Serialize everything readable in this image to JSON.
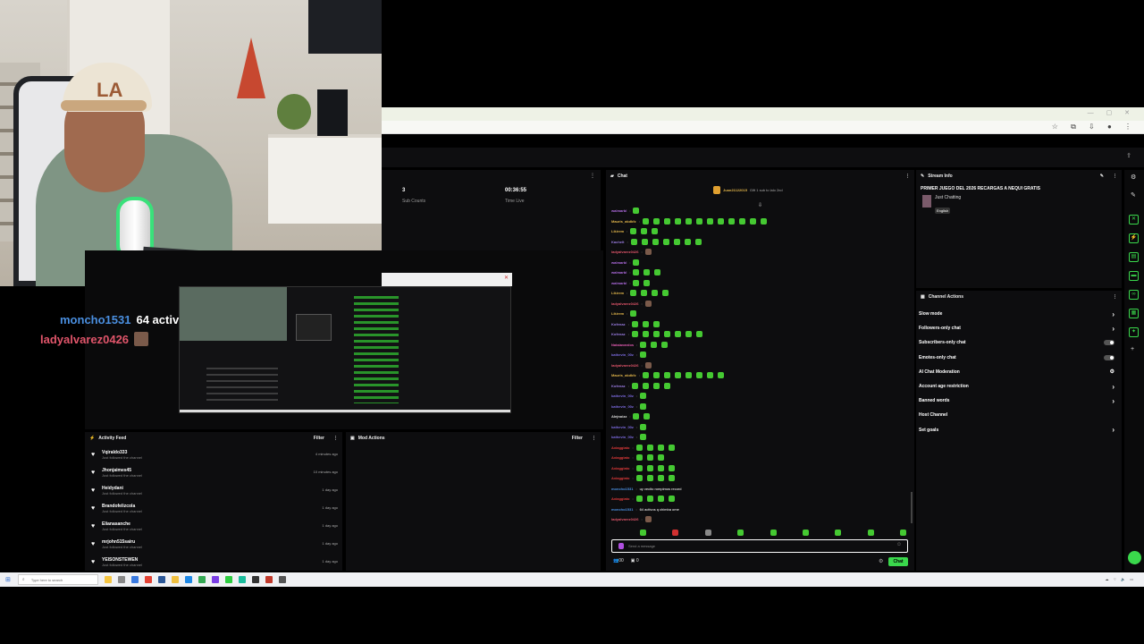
{
  "webcam": {
    "cap_logo": "LA",
    "sign_text": ""
  },
  "overlay": {
    "lines": [
      {
        "name": "moncho1531",
        "message": "64 activos q chimba ome",
        "color": "#4a8fe0"
      },
      {
        "name": "ladyalvarez0426",
        "message": "",
        "color": "#e0556a"
      }
    ]
  },
  "stats": {
    "sub_count": {
      "value": "3",
      "label": "Sub Counts"
    },
    "time_live": {
      "value": "00:36:55",
      "label": "Time Live"
    }
  },
  "activity_feed": {
    "title": "Activity Feed",
    "filter_label": "Filter",
    "items": [
      {
        "name": "Vqiraldo333",
        "action": "Just followed the channel",
        "time": "4 minutes ago"
      },
      {
        "name": "Jhonjaimes45",
        "action": "Just followed the channel",
        "time": "10 minutes ago"
      },
      {
        "name": "Heidydani",
        "action": "Just followed the channel",
        "time": "1 day ago"
      },
      {
        "name": "Brandofelizcola",
        "action": "Just followed the channel",
        "time": "1 day ago"
      },
      {
        "name": "Elianasanche",
        "action": "Just followed the channel",
        "time": "1 day ago"
      },
      {
        "name": "mrjohn515sairu",
        "action": "Just followed the channel",
        "time": "1 day ago"
      },
      {
        "name": "YEISONSTEWEN",
        "action": "Just followed the channel",
        "time": "1 day ago"
      }
    ]
  },
  "mod_actions": {
    "title": "Mod Actions",
    "filter_label": "Filter"
  },
  "chat": {
    "title": "Chat",
    "gift_banner": {
      "user": "Juan21122015",
      "text": "Gift 1 sub to lalo 2nd"
    },
    "lines": [
      {
        "user": "walmarbl",
        "color": "#b06be0",
        "emotes": 1,
        "text": ""
      },
      {
        "user": "Mauris_akdkfz",
        "color": "#e0b44a",
        "emotes": 12,
        "text": ""
      },
      {
        "user": "Likirem",
        "color": "#e0b44a",
        "emotes": 3,
        "text": ""
      },
      {
        "user": "Kachelt",
        "color": "#9a7ce0",
        "emotes": 7,
        "text": ""
      },
      {
        "user": "ladyalvarez0426",
        "color": "#e0556a",
        "emotes": 1,
        "text": ""
      },
      {
        "user": "walmarbl",
        "color": "#b06be0",
        "emotes": 1,
        "text": ""
      },
      {
        "user": "walmarbl",
        "color": "#b06be0",
        "emotes": 3,
        "text": ""
      },
      {
        "user": "walmarbl",
        "color": "#b06be0",
        "emotes": 2,
        "text": ""
      },
      {
        "user": "Likirem",
        "color": "#e0b44a",
        "emotes": 4,
        "text": ""
      },
      {
        "user": "ladyalvarez0426",
        "color": "#e0556a",
        "emotes": 1,
        "text": ""
      },
      {
        "user": "Likirem",
        "color": "#e0b44a",
        "emotes": 1,
        "text": ""
      },
      {
        "user": "Kofenaz",
        "color": "#9a7ce0",
        "emotes": 3,
        "text": ""
      },
      {
        "user": "Kofenaz",
        "color": "#9a7ce0",
        "emotes": 7,
        "text": ""
      },
      {
        "user": "Nataiavardos",
        "color": "#e05bb0",
        "emotes": 3,
        "text": ""
      },
      {
        "user": "kathevin_00z",
        "color": "#7c6be0",
        "emotes": 1,
        "text": ""
      },
      {
        "user": "ladyalvarez0426",
        "color": "#e0556a",
        "emotes": 1,
        "text": ""
      },
      {
        "user": "Mauris_akdkfz",
        "color": "#e0b44a",
        "emotes": 8,
        "text": ""
      },
      {
        "user": "Kofenaz",
        "color": "#9a7ce0",
        "emotes": 4,
        "text": ""
      },
      {
        "user": "kathevin_00z",
        "color": "#7c6be0",
        "emotes": 1,
        "text": ""
      },
      {
        "user": "kathevin_00z",
        "color": "#7c6be0",
        "emotes": 1,
        "text": ""
      },
      {
        "user": "Alejnoizz",
        "color": "#e0e0e0",
        "emotes": 2,
        "text": ""
      },
      {
        "user": "kathevin_00z",
        "color": "#7c6be0",
        "emotes": 1,
        "text": ""
      },
      {
        "user": "kathevin_00z",
        "color": "#7c6be0",
        "emotes": 1,
        "text": ""
      },
      {
        "user": "Axiaggiato",
        "color": "#e03a3a",
        "emotes": 4,
        "text": ""
      },
      {
        "user": "Axiaggiato",
        "color": "#e03a3a",
        "emotes": 3,
        "text": ""
      },
      {
        "user": "Axiaggiato",
        "color": "#e03a3a",
        "emotes": 4,
        "text": ""
      },
      {
        "user": "Axiaggiato",
        "color": "#e03a3a",
        "emotes": 4,
        "text": ""
      },
      {
        "user": "moncho1531",
        "color": "#4a8fe0",
        "emotes": 0,
        "text": "uy vecito rompimos record"
      },
      {
        "user": "Axiaggiato",
        "color": "#e03a3a",
        "emotes": 4,
        "text": ""
      },
      {
        "user": "moncho1531",
        "color": "#4a8fe0",
        "emotes": 0,
        "text": "64 activos q chimba ome"
      },
      {
        "user": "ladyalvarez0426",
        "color": "#e0556a",
        "emotes": 1,
        "text": ""
      }
    ],
    "input_placeholder": "Send a message",
    "viewer_count": "00",
    "points": "0",
    "send_label": "Chat"
  },
  "stream_info": {
    "title": "Stream Info",
    "stream_title": "PRIMER JUEGO DEL 2026 RECARGAS A NEQUI GRATIS",
    "category": "Just Chatting",
    "language": "English"
  },
  "channel_actions": {
    "title": "Channel Actions",
    "items": [
      {
        "label": "Slow mode",
        "control": "chevron"
      },
      {
        "label": "Followers-only chat",
        "control": "chevron"
      },
      {
        "label": "Subscribers-only chat",
        "control": "toggle"
      },
      {
        "label": "Emotes-only chat",
        "control": "toggle"
      },
      {
        "label": "AI Chat Moderation",
        "control": "settings"
      },
      {
        "label": "Account age restriction",
        "control": "chevron"
      },
      {
        "label": "Banned words",
        "control": "chevron"
      },
      {
        "label": "Host Channel",
        "control": "none"
      },
      {
        "label": "Set goals",
        "control": "chevron"
      }
    ]
  },
  "taskbar": {
    "search_placeholder": "Type here to search"
  },
  "colors": {
    "accent": "#3ad84c",
    "panel_bg": "#0d0d0f",
    "emote": "#45c932"
  }
}
